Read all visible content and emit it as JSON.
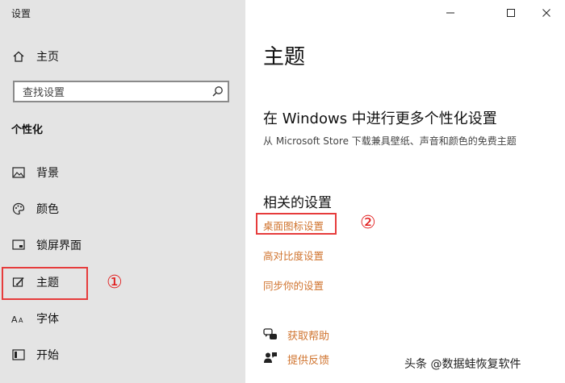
{
  "app": {
    "title": "设置"
  },
  "window_controls": {
    "minimize": "minimize-icon",
    "maximize": "maximize-icon",
    "close": "close-icon"
  },
  "sidebar": {
    "home": {
      "label": "主页",
      "icon": "home-icon"
    },
    "search": {
      "placeholder": "查找设置",
      "icon": "search-icon"
    },
    "section_title": "个性化",
    "items": [
      {
        "label": "背景",
        "icon": "picture-icon"
      },
      {
        "label": "颜色",
        "icon": "palette-icon"
      },
      {
        "label": "锁屏界面",
        "icon": "lock-screen-icon"
      },
      {
        "label": "主题",
        "icon": "theme-brush-icon",
        "selected": true
      },
      {
        "label": "字体",
        "icon": "font-icon"
      },
      {
        "label": "开始",
        "icon": "start-icon"
      }
    ]
  },
  "main": {
    "title": "主题",
    "promo": {
      "title": "在 Windows 中进行更多个性化设置",
      "subtitle": "从 Microsoft Store 下载兼具壁纸、声音和颜色的免费主题"
    },
    "related": {
      "header": "相关的设置",
      "links": [
        "桌面图标设置",
        "高对比度设置",
        "同步你的设置"
      ]
    },
    "help": [
      {
        "label": "获取帮助",
        "icon": "help-chat-icon"
      },
      {
        "label": "提供反馈",
        "icon": "feedback-icon"
      }
    ]
  },
  "annotations": {
    "marker_1": "①",
    "marker_2": "②"
  },
  "watermark": "头条 @数据蛙恢复软件",
  "colors": {
    "link": "#d0742f",
    "sidebar_bg": "#e4e4e4",
    "highlight_box": "#e63c3c"
  }
}
